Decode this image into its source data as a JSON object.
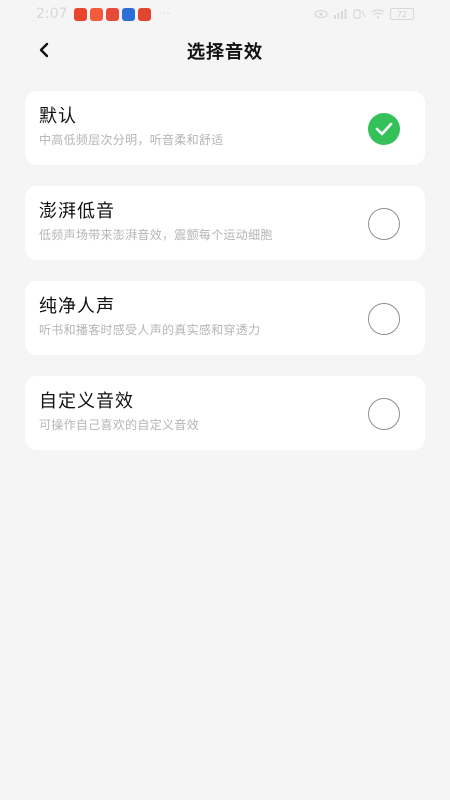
{
  "status_bar": {
    "time": "2:07",
    "battery": "72",
    "app_icon_colors": [
      "#e8452c",
      "#f25c3c",
      "#e84a3a",
      "#2d6fd6",
      "#e0452f"
    ]
  },
  "header": {
    "title": "选择音效"
  },
  "options": [
    {
      "title": "默认",
      "description": "中高低频层次分明，听音柔和舒适",
      "selected": true
    },
    {
      "title": "澎湃低音",
      "description": "低频声场带来澎湃音效，震颤每个运动细胞",
      "selected": false
    },
    {
      "title": "纯净人声",
      "description": "听书和播客时感受人声的真实感和穿透力",
      "selected": false
    },
    {
      "title": "自定义音效",
      "description": "可操作自己喜欢的自定义音效",
      "selected": false
    }
  ],
  "colors": {
    "accent": "#34c15a",
    "background": "#f5f5f5",
    "card": "#ffffff"
  }
}
